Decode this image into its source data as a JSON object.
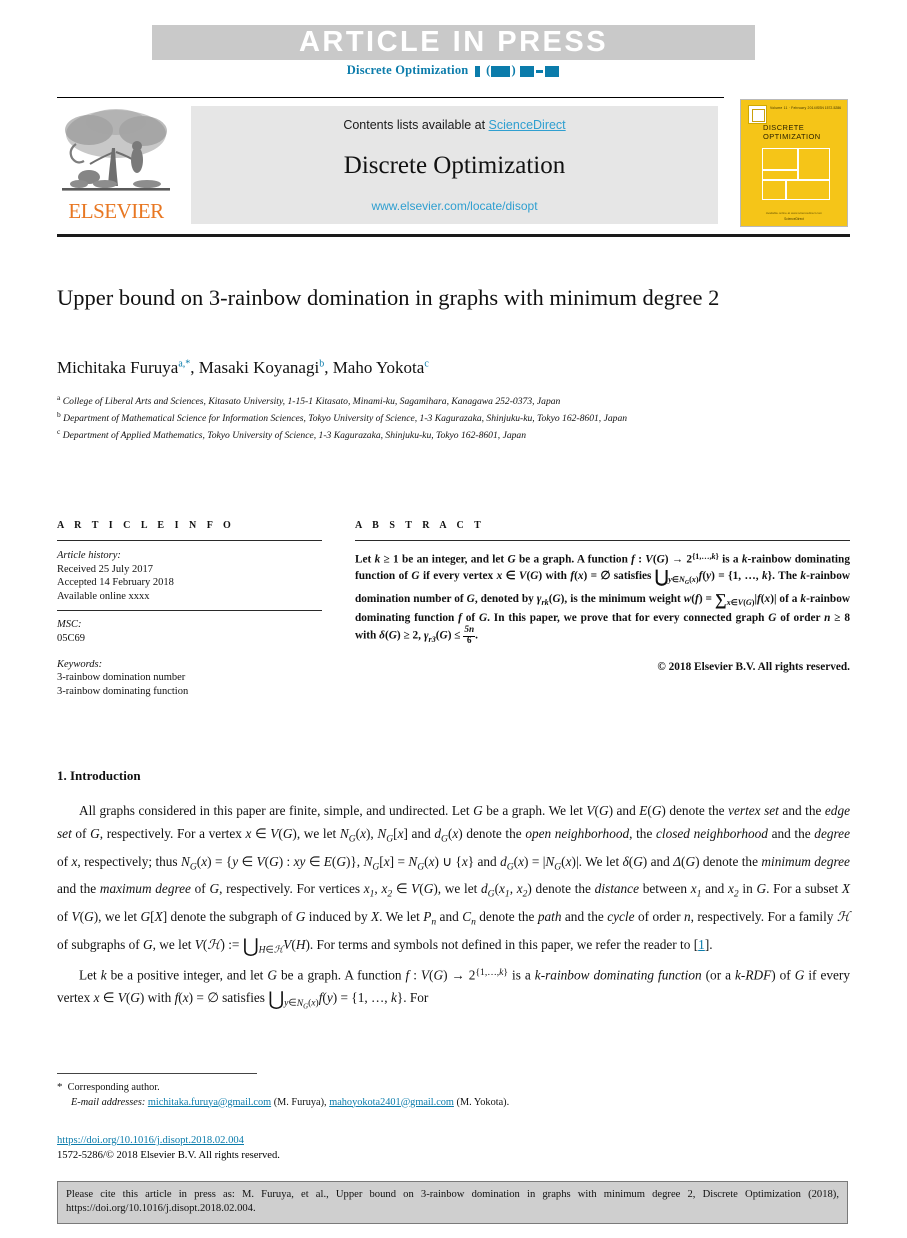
{
  "banner": {
    "article_in_press": "ARTICLE  IN  PRESS",
    "runhead_journal": "Discrete Optimization"
  },
  "masthead": {
    "contents_prefix": "Contents lists available at ",
    "sciencedirect": "ScienceDirect",
    "journal_title": "Discrete Optimization",
    "journal_url": "www.elsevier.com/locate/disopt",
    "publisher": "ELSEVIER",
    "cover": {
      "title_line1": "DISCRETE",
      "title_line2": "OPTIMIZATION",
      "volume_text": "Volume 11 · February 2014",
      "issn_text": "ISSN 1572-5286",
      "footer_text": "Available online at www.sciencedirect.com",
      "footer_brand": "ScienceDirect"
    }
  },
  "article": {
    "title": "Upper bound on 3-rainbow domination in graphs with minimum degree 2",
    "authors": [
      {
        "name": "Michitaka Furuya",
        "marks": "a,*"
      },
      {
        "name": "Masaki Koyanagi",
        "marks": "b"
      },
      {
        "name": "Maho Yokota",
        "marks": "c"
      }
    ],
    "affiliations": [
      {
        "mark": "a",
        "text": "College of Liberal Arts and Sciences, Kitasato University, 1-15-1 Kitasato, Minami-ku, Sagamihara, Kanagawa 252-0373, Japan"
      },
      {
        "mark": "b",
        "text": "Department of Mathematical Science for Information Sciences, Tokyo University of Science, 1-3 Kagurazaka, Shinjuku-ku, Tokyo 162-8601, Japan"
      },
      {
        "mark": "c",
        "text": "Department of Applied Mathematics, Tokyo University of Science, 1-3 Kagurazaka, Shinjuku-ku, Tokyo 162-8601, Japan"
      }
    ]
  },
  "info": {
    "heading": "A R T I C L E   I N F O",
    "history_label": "Article history:",
    "received": "Received 25 July 2017",
    "accepted": "Accepted 14 February 2018",
    "available": "Available online xxxx",
    "msc_label": "MSC:",
    "msc_value": "05C69",
    "keywords_label": "Keywords:",
    "keywords": [
      "3-rainbow domination number",
      "3-rainbow dominating function"
    ]
  },
  "abstract": {
    "heading": "A B S T R A C T",
    "copyright": "© 2018 Elsevier B.V. All rights reserved."
  },
  "body": {
    "section_heading": "1.  Introduction",
    "reference_marker": "1"
  },
  "footnotes": {
    "corresponding": "Corresponding author.",
    "email_label": "E-mail addresses:",
    "email1": "michitaka.furuya@gmail.com",
    "email1_owner": "(M. Furuya),",
    "email2": "mahoyokota2401@gmail.com",
    "email2_owner": "(M. Yokota).",
    "doi": "https://doi.org/10.1016/j.disopt.2018.02.004",
    "issn_line": "1572-5286/© 2018 Elsevier B.V. All rights reserved."
  },
  "cite_box": {
    "text": "Please cite this article in press as: M. Furuya, et al., Upper bound on 3-rainbow domination in graphs with minimum degree 2, Discrete Optimization (2018), https://doi.org/10.1016/j.disopt.2018.02.004."
  },
  "colors": {
    "link": "#0b7cab",
    "sciencedirect": "#2f9fd0",
    "elsevier_orange": "#E87722",
    "banner_gray": "#c9c9c9",
    "cover_yellow": "#f5c518",
    "cite_box_gray": "#cfcfcf"
  }
}
